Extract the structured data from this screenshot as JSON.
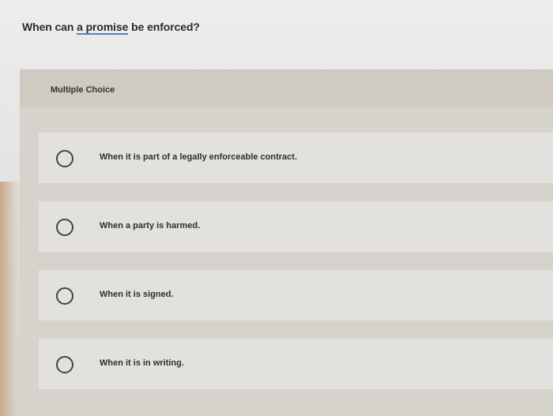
{
  "question": {
    "prefix": "When can ",
    "underlined": "a promise",
    "suffix": " be enforced?"
  },
  "panel": {
    "header_label": "Multiple Choice",
    "options": [
      {
        "label": "When it is part of a legally enforceable contract."
      },
      {
        "label": "When a party is harmed."
      },
      {
        "label": "When it is signed."
      },
      {
        "label": "When it is in writing."
      }
    ]
  },
  "icons": {
    "radio": "radio-circle-icon"
  },
  "colors": {
    "underline_accent": "#5d7fbf",
    "panel_background": "#d6d3cd",
    "option_background": "#e3e1dd"
  }
}
